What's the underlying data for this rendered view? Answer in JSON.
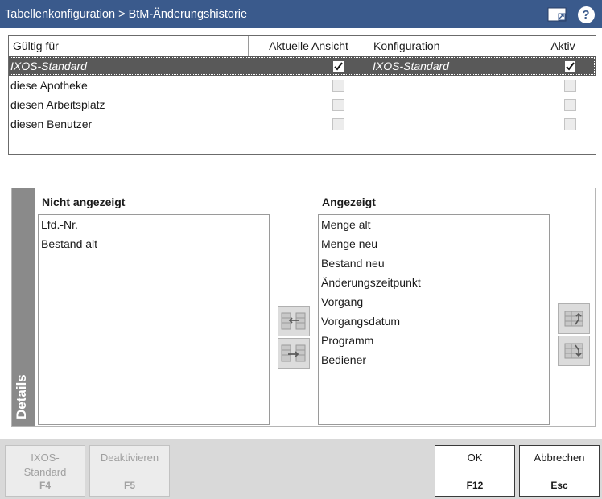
{
  "window": {
    "title": "Tabellenkonfiguration > BtM-Änderungshistorie",
    "help_label": "?"
  },
  "config_table": {
    "headers": {
      "valid_for": "Gültig für",
      "current_view": "Aktuelle Ansicht",
      "configuration": "Konfiguration",
      "active": "Aktiv"
    },
    "rows": [
      {
        "valid_for": "IXOS-Standard",
        "current_view": true,
        "configuration": "IXOS-Standard",
        "active": true,
        "selected": true
      },
      {
        "valid_for": "diese Apotheke",
        "current_view": false,
        "configuration": "",
        "active": false,
        "selected": false
      },
      {
        "valid_for": "diesen Arbeitsplatz",
        "current_view": false,
        "configuration": "",
        "active": false,
        "selected": false
      },
      {
        "valid_for": "diesen Benutzer",
        "current_view": false,
        "configuration": "",
        "active": false,
        "selected": false
      }
    ]
  },
  "details": {
    "tab_label": "Details",
    "not_shown": {
      "title": "Nicht angezeigt",
      "items": [
        "Lfd.-Nr.",
        "Bestand alt"
      ]
    },
    "shown": {
      "title": "Angezeigt",
      "items": [
        "Menge alt",
        "Menge neu",
        "Bestand neu",
        "Änderungszeitpunkt",
        "Vorgang",
        "Vorgangsdatum",
        "Programm",
        "Bediener"
      ]
    },
    "icons": {
      "move_left": "move-left-icon",
      "move_right": "move-right-icon",
      "move_up": "move-up-icon",
      "move_down": "move-down-icon"
    }
  },
  "buttons": {
    "ixos_standard": {
      "label_line1": "IXOS-",
      "label_line2": "Standard",
      "key": "F4"
    },
    "deactivate": {
      "label": "Deaktivieren",
      "key": "F5"
    },
    "ok": {
      "label": "OK",
      "key": "F12"
    },
    "cancel": {
      "label": "Abbrechen",
      "key": "Esc"
    }
  },
  "colors": {
    "titlebar": "#3a5a8c",
    "selected_row": "#595959",
    "details_tab": "#8a8a8a",
    "button_bar": "#d9d9d9"
  }
}
